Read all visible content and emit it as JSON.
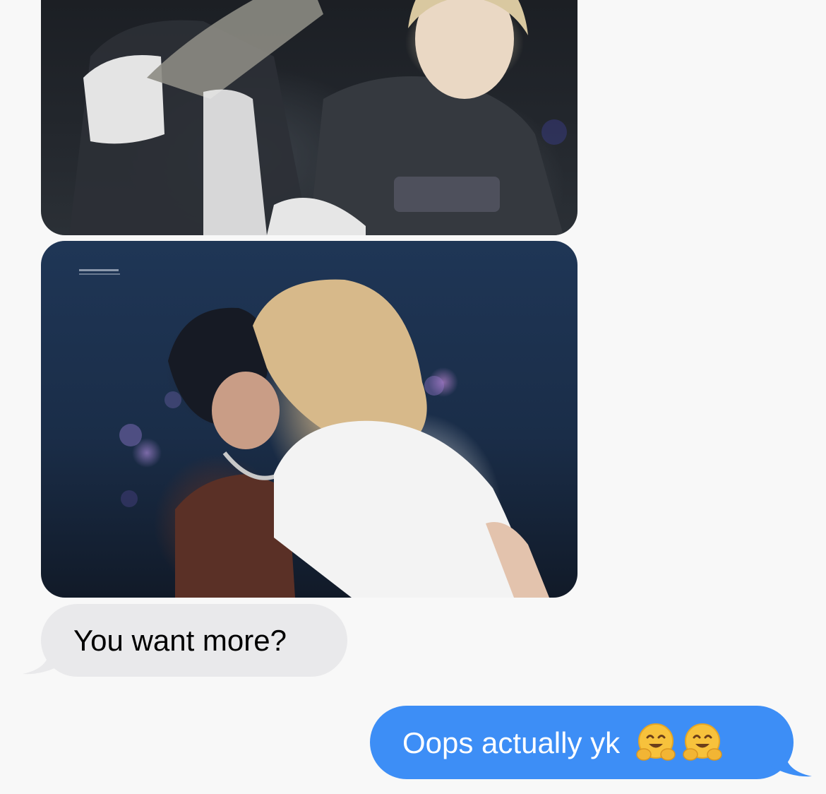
{
  "messages": [
    {
      "type": "image",
      "direction": "received",
      "caption": ""
    },
    {
      "type": "image",
      "direction": "received",
      "caption": ""
    },
    {
      "type": "text",
      "direction": "received",
      "text": "You want more?"
    },
    {
      "type": "text",
      "direction": "sent",
      "text": "Oops actually yk",
      "emoji": [
        "hugging-face-emoji",
        "hugging-face-emoji"
      ]
    }
  ],
  "colors": {
    "background": "#f8f8f8",
    "received_bubble": "#e9e9eb",
    "sent_bubble": "#3d8ef6",
    "received_text": "#000000",
    "sent_text": "#ffffff"
  }
}
